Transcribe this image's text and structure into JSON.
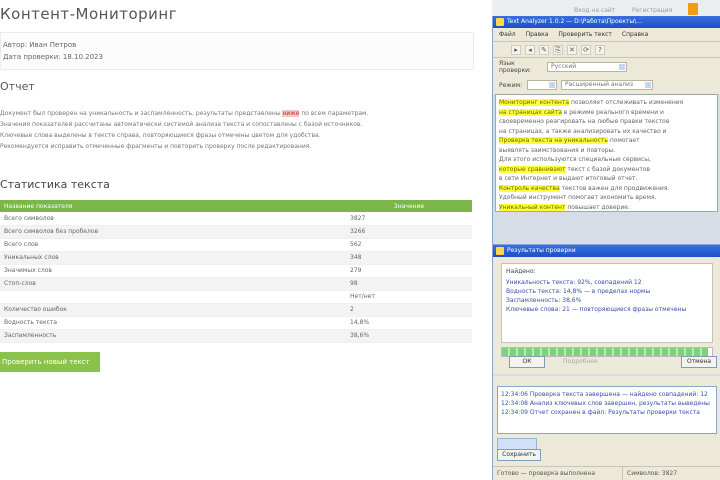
{
  "page": {
    "title": "Контент-Мониторинг",
    "meta": [
      "Автор: Иван Петров",
      "Дата проверки: 18.10.2023"
    ],
    "section_heading": "Отчет",
    "description": [
      {
        "pre": "Документ был проверен на уникальность и заспамленность, результаты представлены ",
        "hl": "ниже",
        "post": " по всем параметрам."
      },
      {
        "pre": "Значения показателей рассчитаны автоматически системой анализа текста и сопоставлены с базой источников.",
        "hl": "",
        "post": ""
      },
      {
        "pre": "Ключевые слова выделены в тексте справа, повторяющиеся фразы отмечены цветом для удобства.",
        "hl": "",
        "post": ""
      },
      {
        "pre": "Рекомендуется исправить отмеченные фрагменты и повторить проверку после редактирования.",
        "hl": "",
        "post": ""
      }
    ],
    "stats_heading": "Статистика текста",
    "table": {
      "headers": [
        "Название показателя",
        "Значение"
      ],
      "rows": [
        [
          "Всего символов",
          "3827"
        ],
        [
          "Всего символов без пробелов",
          "3266"
        ],
        [
          "Всего слов",
          "562"
        ],
        [
          "Уникальных слов",
          "348"
        ],
        [
          "Значимых слов",
          "279"
        ],
        [
          "Стоп-слов",
          "98"
        ],
        [
          "",
          "Нет/нет"
        ],
        [
          "Количество ошибок",
          "2"
        ],
        [
          "Водность текста",
          "14,8%"
        ],
        [
          "Заспамленность",
          "38,6%"
        ]
      ]
    },
    "check_button": "Проверить новый текст",
    "top_links": [
      "Вход на сайт",
      "Регистрация"
    ]
  },
  "tool": {
    "title": "Text Analyzer 1.0.2 — D:\\Работа\\Проекты\\...",
    "menu": [
      "Файл",
      "Правка",
      "Проверить текст",
      "Справка"
    ],
    "toolbar": [
      "▸",
      "◂",
      "✎",
      "⎘",
      "✕",
      "⟳",
      "?"
    ],
    "language_label": "Язык проверки:",
    "language_value": "Русский",
    "mode_label": "Режим:",
    "mode_value": "Расширенный анализ",
    "text_lines": [
      {
        "hl": "Мониторинг контента",
        "post": " позволяет отслеживать изменения"
      },
      {
        "hl": "на страницах сайта",
        "post": " в режиме реального времени и"
      },
      {
        "hl": "",
        "post": "своевременно реагировать на любые правки текстов"
      },
      {
        "hl": "",
        "post": "на страницах, а также анализировать их качество и"
      },
      {
        "hl": "Проверка текста на уникальность",
        "post": " помогает"
      },
      {
        "hl": "",
        "post": "выявлять заимствования и повторы."
      },
      {
        "hl": "",
        "post": "Для этого используются специальные сервисы,"
      },
      {
        "hl": "которые сравнивают",
        "post": " текст с базой документов"
      },
      {
        "hl": "",
        "post": "в сети Интернет и выдают итоговый отчет."
      },
      {
        "hl": "Контроль качества",
        "post": " текстов важен для продвижения."
      },
      {
        "hl": "",
        "post": "Удобный инструмент помогает экономить время."
      },
      {
        "hl": "Уникальный контент",
        "post": " повышает доверие."
      }
    ],
    "results": {
      "title": "Результаты проверки",
      "label": "Найдено:",
      "lines": [
        "Уникальность текста: 92%, совпадений 12",
        "Водность текста: 14,8% — в пределах нормы",
        "Заспамленность: 38,6%",
        "Ключевые слова: 21 — повторяющиеся фразы отмечены"
      ],
      "progress": 0.98,
      "ok_button": "ОК",
      "details_label": "Подробнее",
      "cancel_button": "Отмена"
    },
    "log": {
      "lines": [
        "12:34:06 Проверка текста завершена — найдено совпадений: 12",
        "12:34:08 Анализ ключевых слов завершен, результаты выведены",
        "12:34:09 Отчет сохранен в файл: Результаты проверки текста"
      ],
      "save_button": "Сохранить"
    },
    "statusbar": [
      "Готово — проверка выполнена",
      "Символов: 3827"
    ]
  },
  "colors": {
    "accent": "#7ab648",
    "highlight": "#ffff3c",
    "titlebar": "#1c4fc4"
  }
}
